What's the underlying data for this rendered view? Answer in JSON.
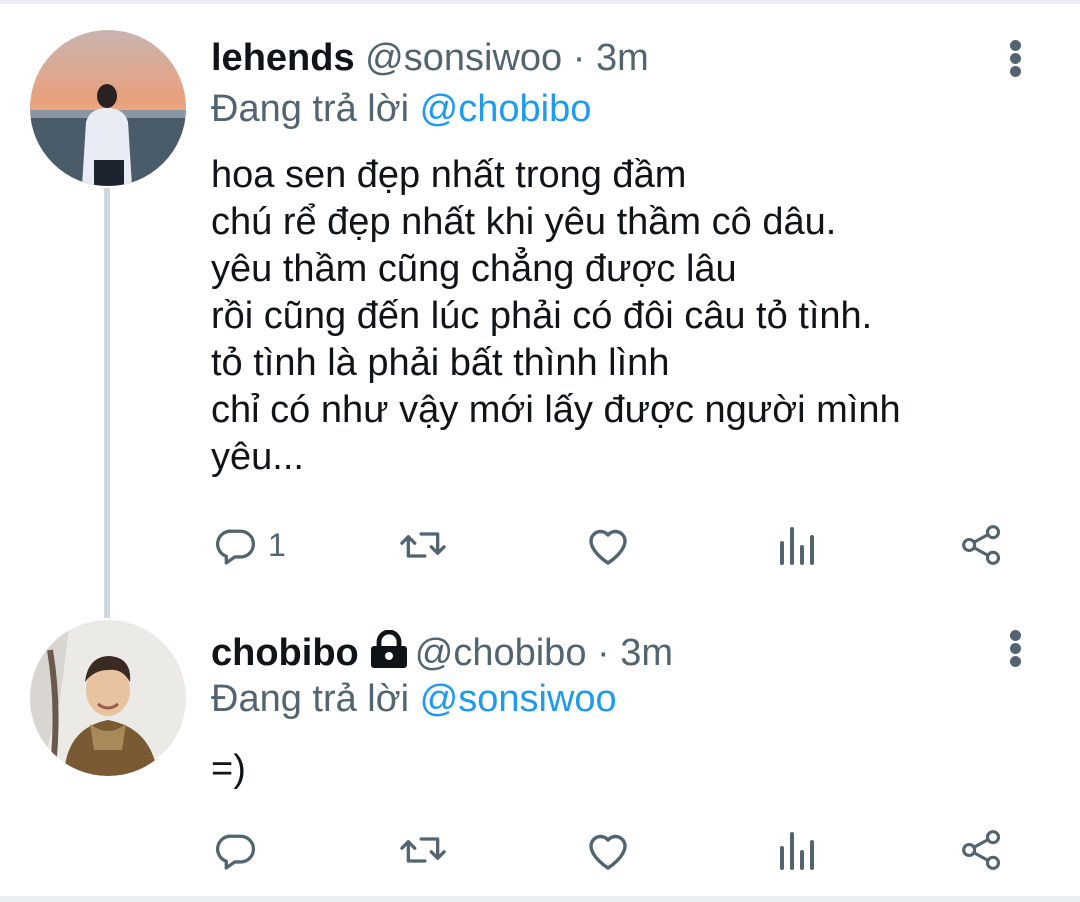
{
  "tweets": [
    {
      "name": "lehends",
      "handle": "@sonsiwoo",
      "time": "· 3m",
      "reply_prefix": "Đang trả lời",
      "reply_mention": "@chobibo",
      "text": "hoa sen đẹp nhất trong đầm\nchú rể đẹp nhất khi yêu thầm cô dâu.\nyêu thầm cũng chẳng được lâu\nrồi cũng đến lúc phải có đôi câu tỏ tình.\ntỏ tình là phải bất thình lình\nchỉ có như vậy mới lấy được người mình\nyêu...",
      "reply_count": "1",
      "avatar_icon": "profile-photo-sunset"
    },
    {
      "name": "chobibo",
      "handle": "@chobibo",
      "time": "· 3m",
      "reply_prefix": "Đang trả lời",
      "reply_mention": "@sonsiwoo",
      "text": "=)",
      "reply_count": "",
      "avatar_icon": "profile-photo-snow"
    }
  ],
  "icons": {
    "reply": "reply-icon",
    "retweet": "retweet-icon",
    "like": "heart-icon",
    "analytics": "analytics-icon",
    "share": "share-icon",
    "more": "more-vertical-icon",
    "lock": "lock-icon"
  },
  "colors": {
    "text": "#0f1419",
    "secondary": "#536471",
    "accent": "#1d9bf0",
    "divider": "#ebeef0",
    "thread_line": "#cfd9de"
  }
}
